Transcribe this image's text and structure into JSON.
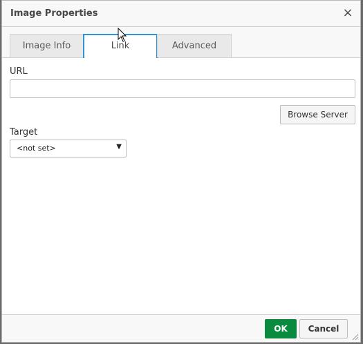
{
  "dialog": {
    "title": "Image Properties",
    "close_icon": "×"
  },
  "tabs": [
    {
      "label": "Image Info",
      "active": false
    },
    {
      "label": "Link",
      "active": true
    },
    {
      "label": "Advanced",
      "active": false
    }
  ],
  "link": {
    "url_label": "URL",
    "url_value": "",
    "browse_label": "Browse Server",
    "target_label": "Target",
    "target_selected": "<not set>",
    "target_arrow": "▼"
  },
  "footer": {
    "ok_label": "OK",
    "cancel_label": "Cancel"
  },
  "colors": {
    "accent": "#2f93d8",
    "ok": "#0a8a3e"
  }
}
